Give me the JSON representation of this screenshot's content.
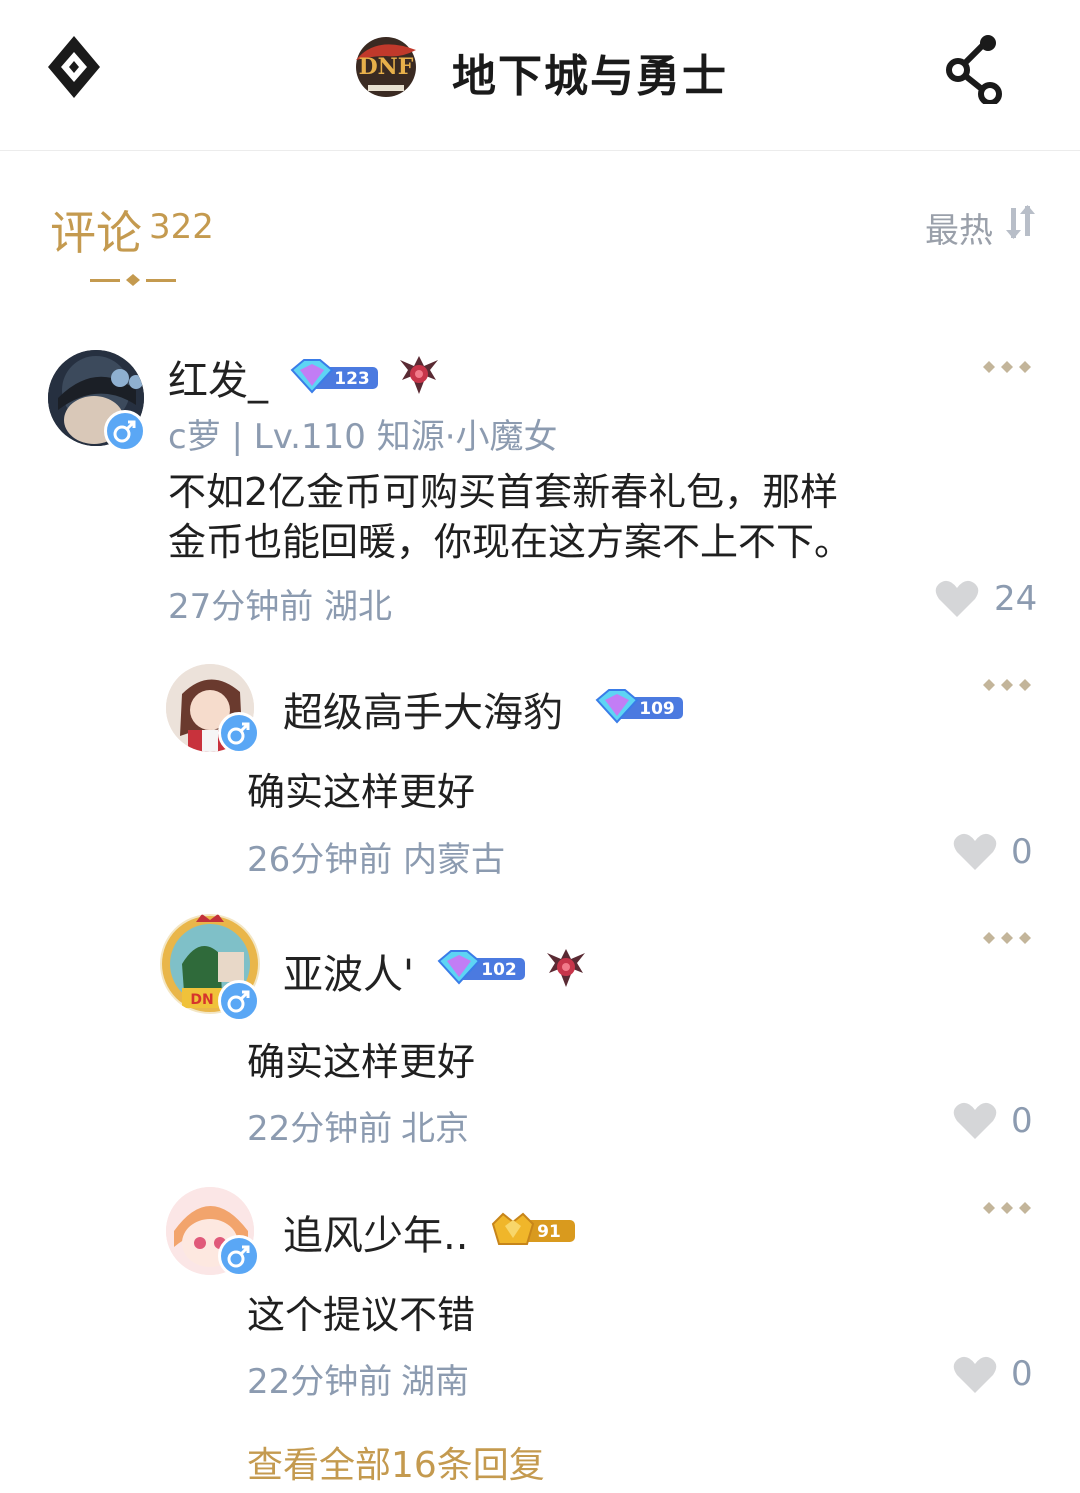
{
  "header": {
    "title": "地下城与勇士",
    "logo_icon": "dnf-logo-icon",
    "left_icon": "diamond-menu-icon",
    "right_icon": "share-icon"
  },
  "comments_header": {
    "label": "评论",
    "count": "322",
    "sort_label": "最热"
  },
  "comments": [
    {
      "username": "红发_",
      "level_badge": "123",
      "user_info": "c萝 | Lv.110 知源·小魔女",
      "text_lines": [
        "不如2亿金币可购买首套新春礼包，那样",
        "金币也能回暖，你现在这方案不上不下。"
      ],
      "time": "27分钟前",
      "location": "湖北",
      "likes": "24"
    }
  ],
  "replies": [
    {
      "username": "超级高手大海豹",
      "level_badge": "109",
      "text": "确实这样更好",
      "time": "26分钟前",
      "location": "内蒙古",
      "likes": "0"
    },
    {
      "username": "亚波人'",
      "level_badge": "102",
      "text": "确实这样更好",
      "time": "22分钟前",
      "location": "北京",
      "likes": "0"
    },
    {
      "username": "追风少年..",
      "level_badge": "91",
      "text": "这个提议不错",
      "time": "22分钟前",
      "location": "湖南",
      "likes": "0"
    }
  ],
  "view_all_replies": "查看全部16条回复",
  "colors": {
    "accent_gold": "#c49a4f",
    "meta_gray": "#8c9bb0",
    "gender_blue": "#5aa7f5"
  }
}
